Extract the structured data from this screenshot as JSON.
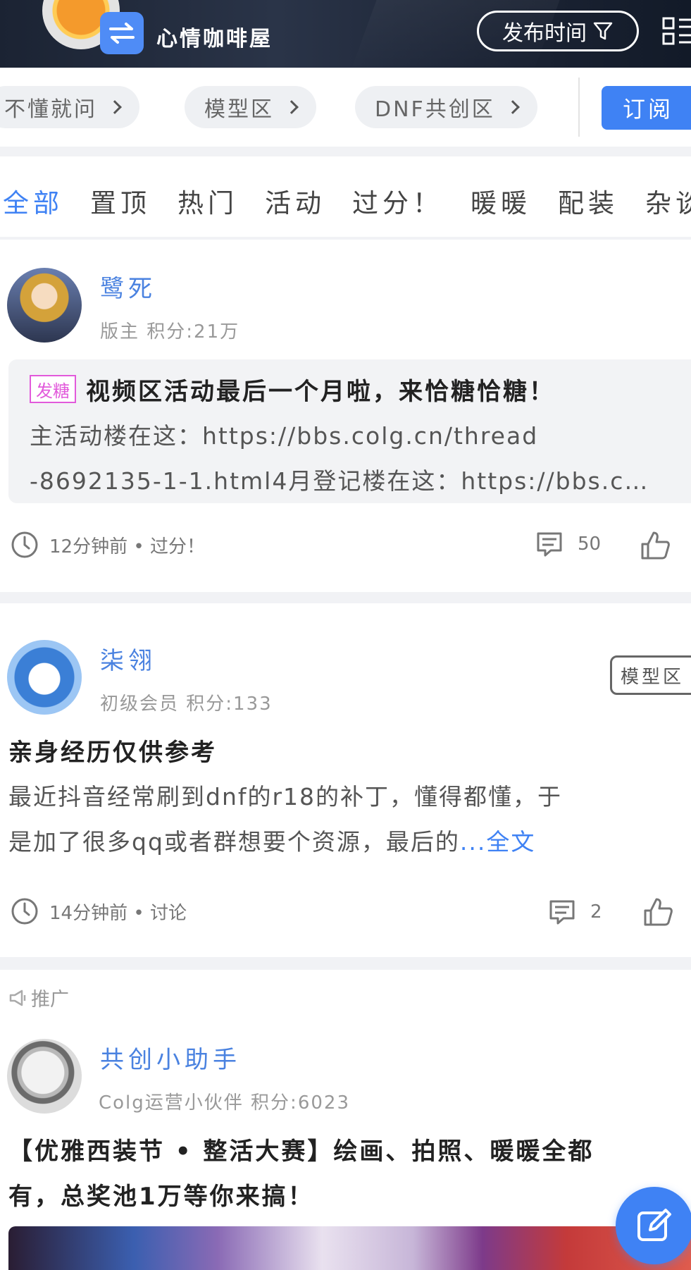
{
  "header": {
    "forum_name": "心情咖啡屋",
    "sort_button": "发布时间"
  },
  "subforums": {
    "chips": [
      "不懂就问",
      "模型区",
      "DNF共创区"
    ],
    "subscribe": "订阅"
  },
  "tabs": [
    "全部",
    "置顶",
    "热门",
    "活动",
    "过分！",
    "暖暖",
    "配装",
    "杂谈"
  ],
  "posts": [
    {
      "username": "鹭死",
      "meta": "版主  积分:21万",
      "tag": "发糖",
      "title": "视频区活动最后一个月啦，来恰糖恰糖！",
      "text_line1": "主活动楼在这：https://bbs.colg.cn/thread",
      "text_line2": "-8692135-1-1.html4月登记楼在这：https://bbs.c…",
      "time_category": "12分钟前 • 过分！",
      "comments": "50"
    },
    {
      "username": "柒翎",
      "meta": "初级会员  积分:133",
      "board": "模型区",
      "title": "亲身经历仅供参考",
      "text_line1": "最近抖音经常刷到dnf的r18的补丁，懂得都懂，于",
      "text_line2": "是加了很多qq或者群想要个资源，最后的",
      "more": "...全文",
      "time_category": "14分钟前 • 讨论",
      "comments": "2"
    },
    {
      "promo_label": "推广",
      "username": "共创小助手",
      "meta": "Colg运营小伙伴  积分:6023",
      "title_line1": "【优雅西装节 • 整活大赛】绘画、拍照、暖暖全都",
      "title_line2": "有，总奖池1万等你来搞！"
    }
  ],
  "colors": {
    "accent": "#3f82f4",
    "username": "#4a82e0",
    "tag_pink": "#e25adb",
    "header_bg": "#1b2333"
  }
}
